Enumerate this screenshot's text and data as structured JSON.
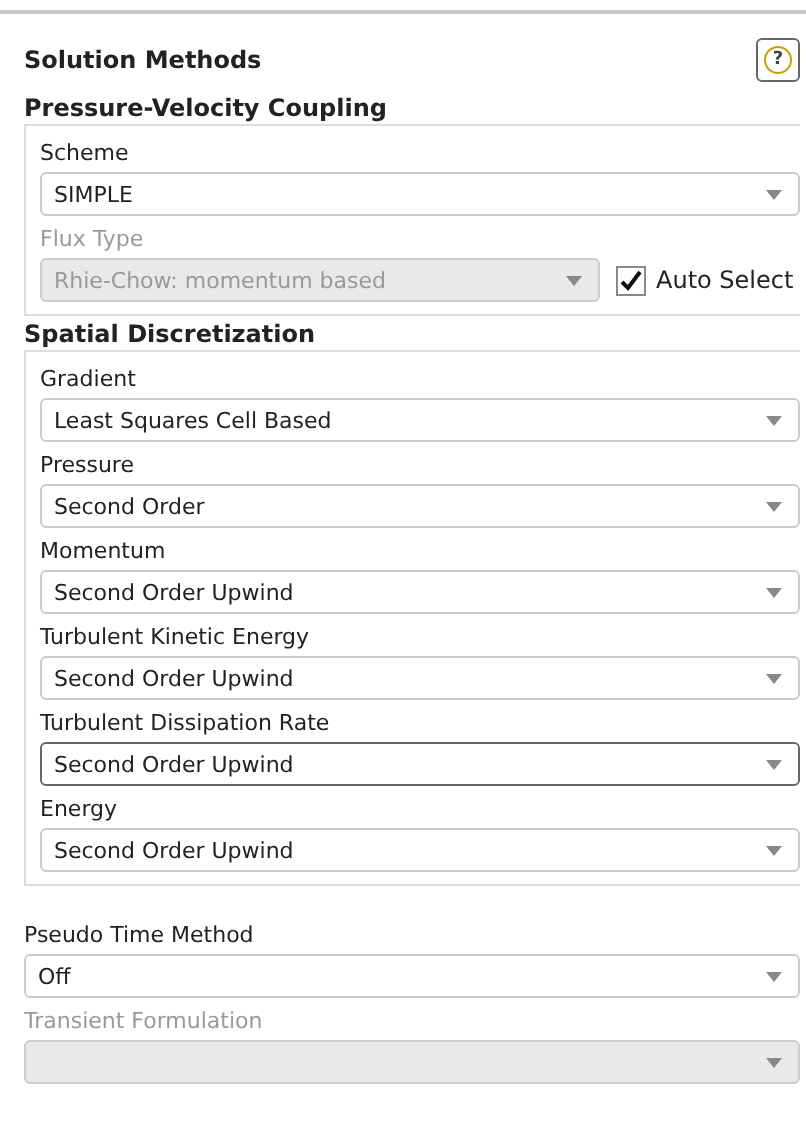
{
  "panel": {
    "title": "Solution Methods",
    "help_icon_text": "?"
  },
  "groups": [
    {
      "title": "Pressure-Velocity Coupling",
      "fields": [
        {
          "label": "Scheme",
          "value": "SIMPLE",
          "disabled": false,
          "focused": false
        },
        {
          "label": "Flux Type",
          "value": "Rhie-Chow: momentum based",
          "disabled": true,
          "focused": false,
          "checkbox": {
            "label": "Auto Select",
            "checked": true
          }
        }
      ]
    },
    {
      "title": "Spatial Discretization",
      "fields": [
        {
          "label": "Gradient",
          "value": "Least Squares Cell Based",
          "disabled": false,
          "focused": false
        },
        {
          "label": "Pressure",
          "value": "Second Order",
          "disabled": false,
          "focused": false
        },
        {
          "label": "Momentum",
          "value": "Second Order Upwind",
          "disabled": false,
          "focused": false
        },
        {
          "label": "Turbulent Kinetic Energy",
          "value": "Second Order Upwind",
          "disabled": false,
          "focused": false
        },
        {
          "label": "Turbulent Dissipation Rate",
          "value": "Second Order Upwind",
          "disabled": false,
          "focused": true
        },
        {
          "label": "Energy",
          "value": "Second Order Upwind",
          "disabled": false,
          "focused": false
        }
      ]
    }
  ],
  "fields": [
    {
      "label": "Pseudo Time Method",
      "value": "Off",
      "disabled": false,
      "focused": false
    },
    {
      "label": "Transient Formulation",
      "disabled": true,
      "focused": false
    }
  ]
}
